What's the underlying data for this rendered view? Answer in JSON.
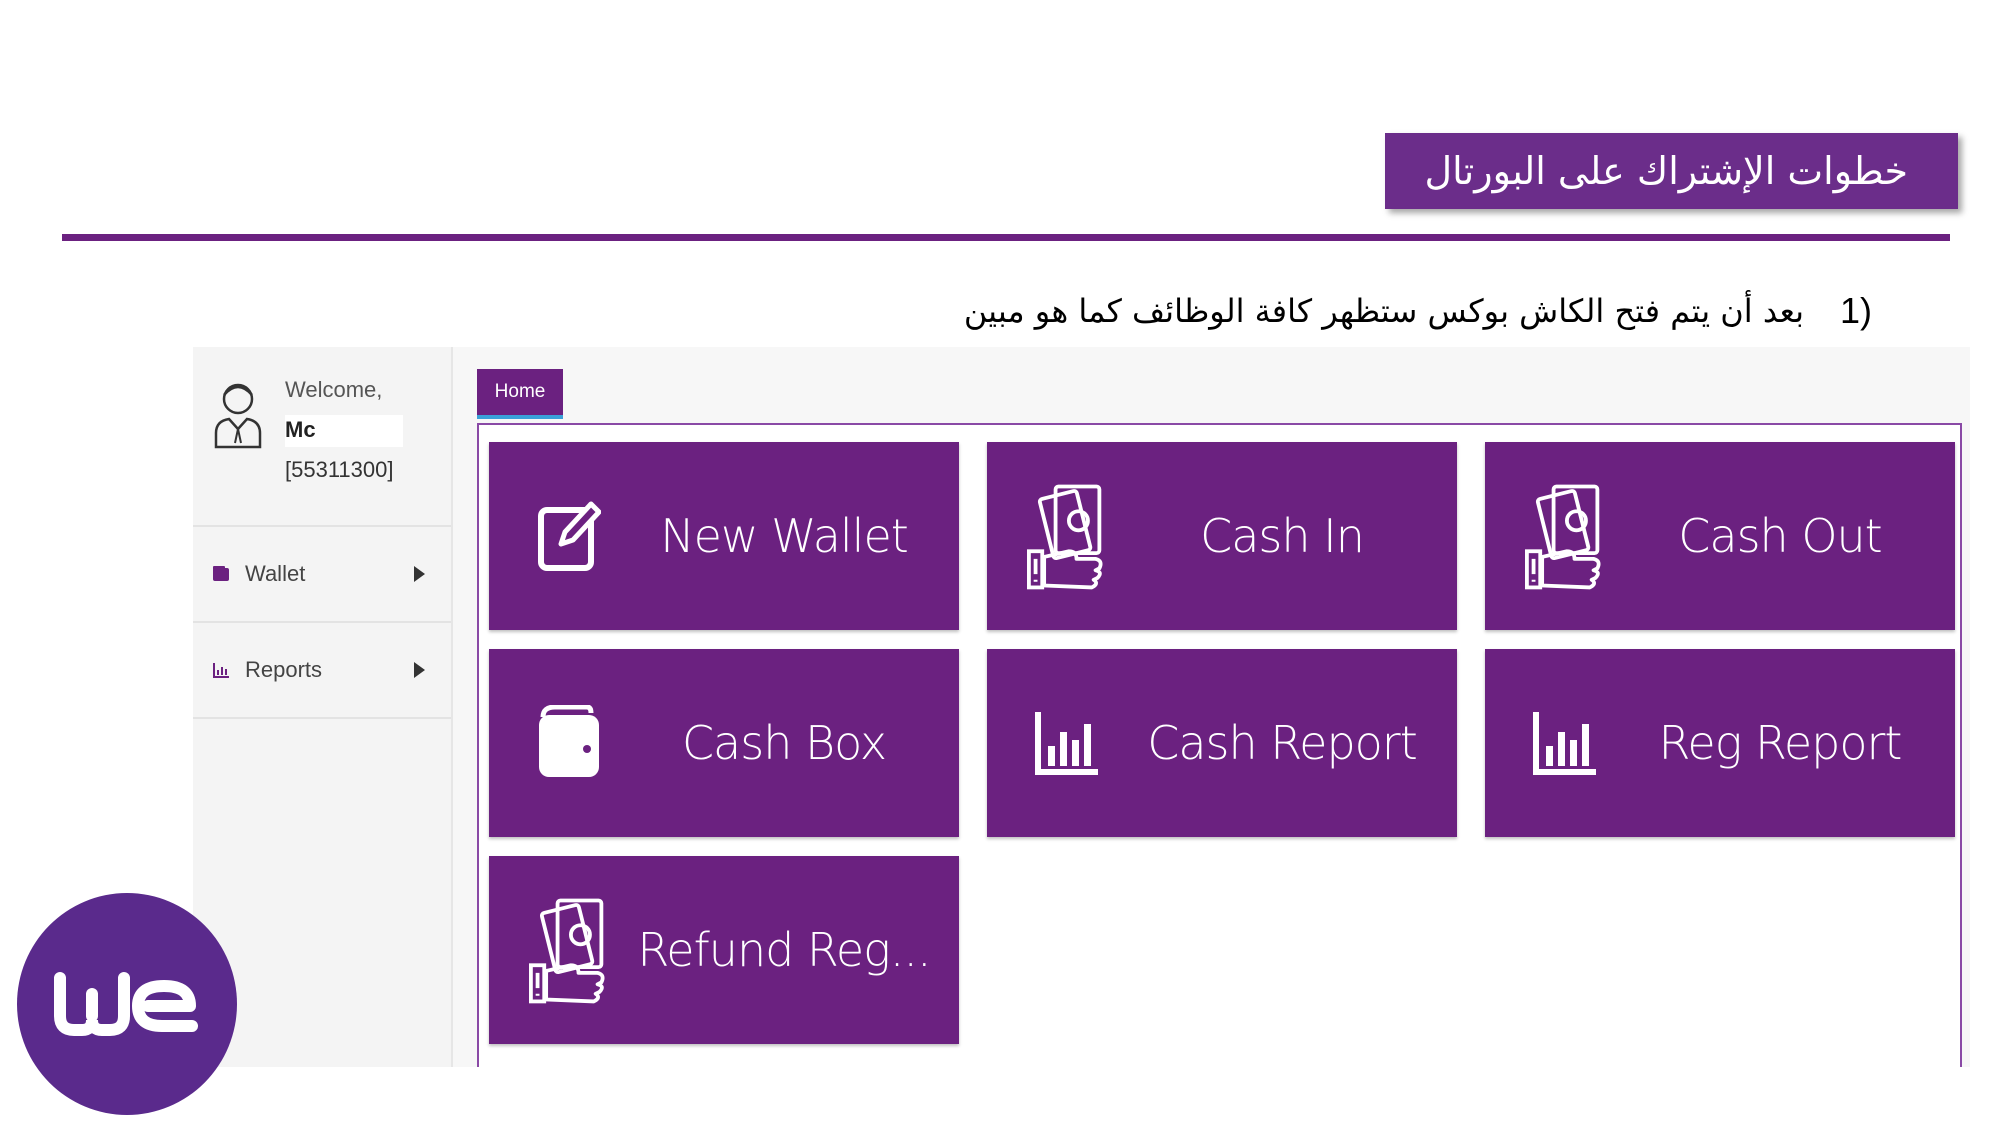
{
  "slide": {
    "title": "خطوات الإشتراك على البورتال",
    "step_number": "1)",
    "step_text": "بعد أن يتم فتح الكاش بوكس ستظهر كافة الوظائف كما هو مبين"
  },
  "sidebar": {
    "welcome": "Welcome,",
    "username": "Mc",
    "user_id": "[55311300]",
    "items": [
      {
        "label": "Wallet",
        "icon": "wallet-icon"
      },
      {
        "label": "Reports",
        "icon": "chart-icon"
      }
    ]
  },
  "tabs": [
    {
      "label": "Home",
      "active": true
    }
  ],
  "tiles": [
    {
      "label": "New Wallet",
      "icon": "edit-icon"
    },
    {
      "label": "Cash In",
      "icon": "cash-hand-icon"
    },
    {
      "label": "Cash Out",
      "icon": "cash-hand-icon"
    },
    {
      "label": "Cash Box",
      "icon": "wallet-icon"
    },
    {
      "label": "Cash Report",
      "icon": "bar-chart-icon"
    },
    {
      "label": "Reg Report",
      "icon": "bar-chart-icon"
    },
    {
      "label": "Refund Reg...",
      "icon": "cash-hand-icon"
    }
  ],
  "colors": {
    "brand_purple": "#6b2180",
    "title_purple": "#6b2d8a",
    "logo_purple": "#5a2a8c",
    "tab_underline": "#3aa0d8"
  },
  "logo": {
    "text": "we"
  }
}
